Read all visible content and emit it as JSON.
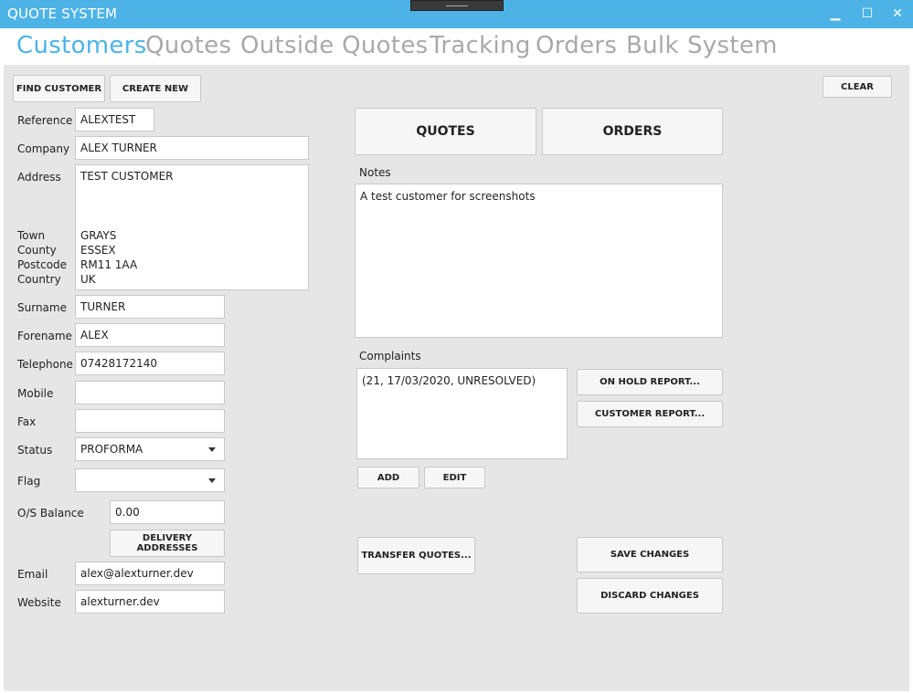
{
  "window": {
    "title": "QUOTE SYSTEM",
    "minimize": "▁",
    "maximize": "☐",
    "close": "✕"
  },
  "nav": {
    "customers": "Customers",
    "quotes": "Quotes",
    "outside_quotes": "Outside Quotes",
    "tracking": "Tracking",
    "orders": "Orders",
    "bulk": "Bulk",
    "system": "System"
  },
  "toolbar": {
    "find_customer": "FIND CUSTOMER",
    "create_new": "CREATE NEW",
    "clear": "CLEAR"
  },
  "form": {
    "reference_label": "Reference",
    "reference": "ALEXTEST",
    "company_label": "Company",
    "company": "ALEX TURNER",
    "address_label": "Address",
    "address": "TEST CUSTOMER",
    "town_label": "Town",
    "town": "GRAYS",
    "county_label": "County",
    "county": "ESSEX",
    "postcode_label": "Postcode",
    "postcode": "RM11 1AA",
    "country_label": "Country",
    "country": "UK",
    "surname_label": "Surname",
    "surname": "TURNER",
    "forename_label": "Forename",
    "forename": "ALEX",
    "telephone_label": "Telephone",
    "telephone": "07428172140",
    "mobile_label": "Mobile",
    "mobile": "",
    "fax_label": "Fax",
    "fax": "",
    "status_label": "Status",
    "status": "PROFORMA",
    "flag_label": "Flag",
    "flag": "",
    "balance_label": "O/S Balance",
    "balance": "0.00",
    "delivery_addresses": "DELIVERY ADDRESSES",
    "email_label": "Email",
    "email": "alex@alexturner.dev",
    "website_label": "Website",
    "website": "alexturner.dev"
  },
  "right": {
    "quotes_button": "QUOTES",
    "orders_button": "ORDERS",
    "notes_label": "Notes",
    "notes": "A test customer for screenshots",
    "complaints_label": "Complaints",
    "complaints": [
      "(21, 17/03/2020, UNRESOLVED)"
    ],
    "add": "ADD",
    "edit": "EDIT",
    "on_hold_report": "ON HOLD REPORT...",
    "customer_report": "CUSTOMER REPORT...",
    "transfer_quotes": "TRANSFER QUOTES...",
    "save_changes": "SAVE CHANGES",
    "discard_changes": "DISCARD CHANGES"
  }
}
